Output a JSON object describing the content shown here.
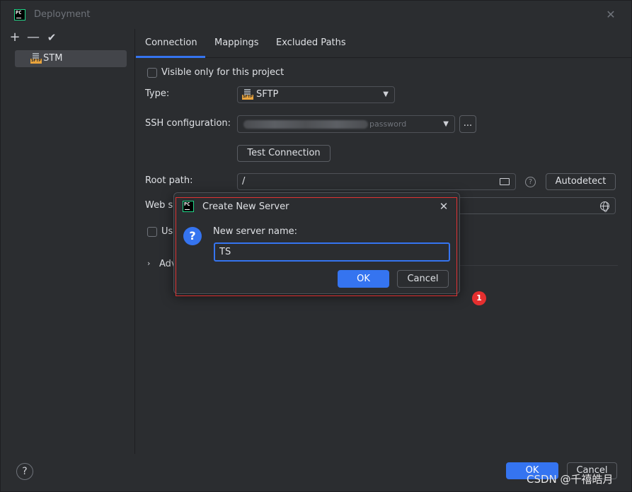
{
  "window": {
    "title": "Deployment",
    "close_glyph": "✕"
  },
  "left_toolbar": {
    "add_glyph": "+",
    "remove_glyph": "—",
    "apply_glyph": "✔"
  },
  "servers": [
    {
      "label": "STM",
      "icon": "sftp-icon",
      "icon_tag": "SFTP",
      "selected": true
    }
  ],
  "tabs": [
    {
      "label": "Connection",
      "active": true
    },
    {
      "label": "Mappings",
      "active": false
    },
    {
      "label": "Excluded Paths",
      "active": false
    }
  ],
  "connection": {
    "visible_only_label": "Visible only for this project",
    "visible_only_checked": false,
    "type_label": "Type:",
    "type_value": "SFTP",
    "ssh_label": "SSH configuration:",
    "ssh_value_suffix": "password",
    "ssh_more_label": "...",
    "test_button": "Test Connection",
    "root_path_label": "Root path:",
    "root_path_value": "/",
    "help_glyph": "?",
    "autodetect_button": "Autodetect",
    "web_server_label": "Web se",
    "use_label": "Us",
    "use_checked": false,
    "advanced_label": "Adv",
    "advanced_chevron": "›"
  },
  "bottom": {
    "help_glyph": "?",
    "ok_label": "OK",
    "cancel_label": "Cancel"
  },
  "dialog": {
    "title": "Create New Server",
    "close_glyph": "✕",
    "question_glyph": "?",
    "prompt_label": "New server name:",
    "name_value": "TS",
    "ok_label": "OK",
    "cancel_label": "Cancel"
  },
  "annotation": {
    "step_number": "1",
    "highlight_color": "#e03333"
  },
  "watermark": "CSDN @千禧皓月",
  "colors": {
    "background": "#2b2d30",
    "accent": "#3574f0",
    "text": "#dfe1e5",
    "badge": "#e52f2f",
    "sftp_tag": "#e8a33d"
  }
}
